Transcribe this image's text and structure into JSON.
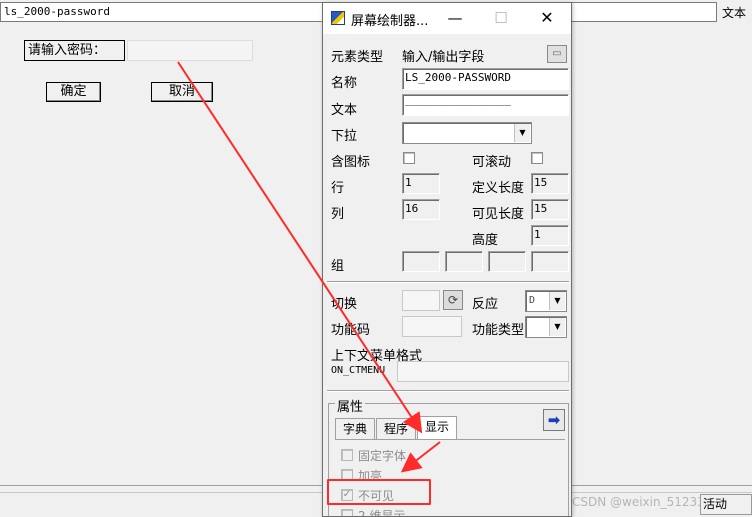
{
  "canvas": {
    "top_field_value": "ls_2000-password",
    "top_right_label": "文本",
    "password_label": "请输入密码：",
    "ok_button": "确定",
    "cancel_button": "取消"
  },
  "status_bar": {
    "right_text": "活动",
    "watermark": "CSDN @weixin_51233"
  },
  "dialog": {
    "title": "屏幕绘制器...",
    "controls": {
      "minimize": "—",
      "maximize": "☐",
      "close": "✕"
    },
    "element_type_label": "元素类型",
    "element_type_value": "输入/输出字段",
    "name_label": "名称",
    "name_value": "LS_2000-PASSWORD",
    "text_label": "文本",
    "text_value": "________________",
    "dropdown_label": "下拉",
    "with_icon_label": "含图标",
    "scrollable_label": "可滚动",
    "row_label": "行",
    "row_value": "1",
    "def_length_label": "定义长度",
    "def_length_value": "15",
    "col_label": "列",
    "col_value": "16",
    "vis_length_label": "可见长度",
    "vis_length_value": "15",
    "height_label": "高度",
    "height_value": "1",
    "group_label": "组",
    "switch_label": "切换",
    "reaction_label": "反应",
    "reaction_value": "D",
    "func_code_label": "功能码",
    "func_type_label": "功能类型",
    "context_menu_label": "上下文菜单格式",
    "on_ctmenu_label": "ON_CTMENU",
    "attributes_label": "属性",
    "tabs": [
      {
        "label": "字典"
      },
      {
        "label": "程序"
      },
      {
        "label": "显示"
      }
    ],
    "options": [
      {
        "label": "固定字体",
        "checked": false
      },
      {
        "label": "加亮",
        "checked": false
      },
      {
        "label": "不可见",
        "checked": true
      },
      {
        "label": "2 维显示",
        "checked": false
      }
    ]
  },
  "colors": {
    "annotation_red": "#ff2a2a",
    "arrow_blue": "#1b3fbf"
  }
}
